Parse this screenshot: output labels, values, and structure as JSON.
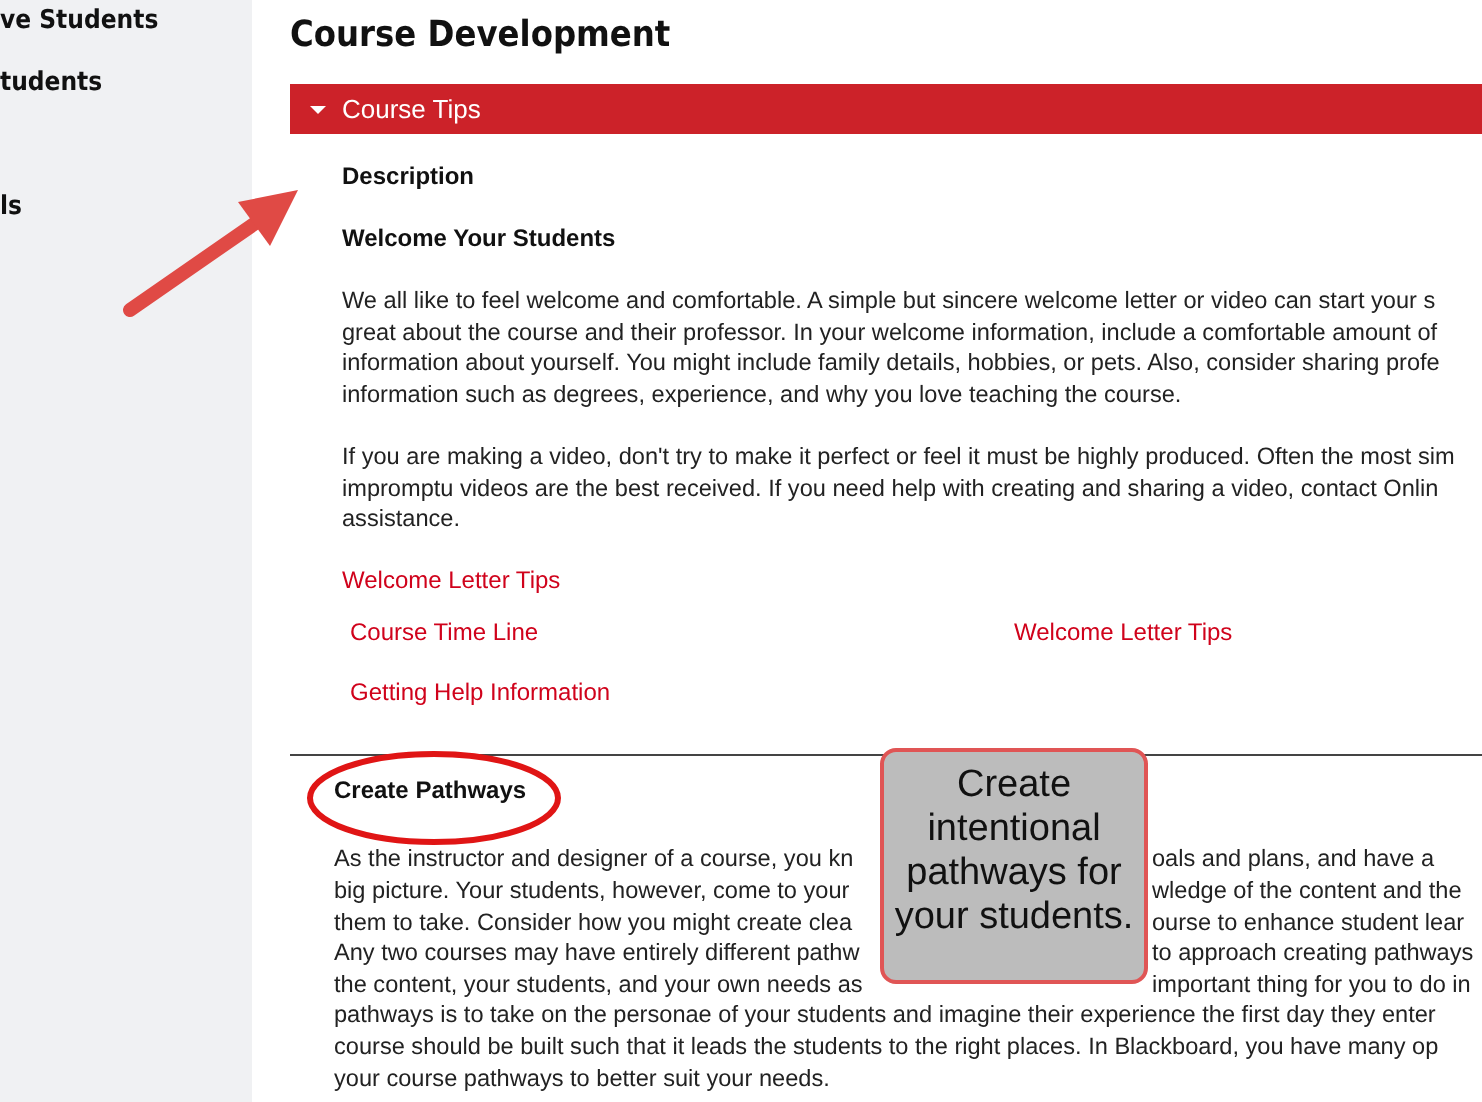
{
  "sidebar": {
    "items": [
      {
        "label": "ve Students"
      },
      {
        "label": "tudents"
      },
      {
        "label": "ls"
      }
    ]
  },
  "page_title": "Course Development",
  "section": {
    "title": "Course Tips",
    "expanded": true
  },
  "description_heading": "Description",
  "welcome": {
    "heading": "Welcome Your Students",
    "paragraphs": [
      [
        "We all like to feel welcome and comfortable. A simple but sincere welcome letter or video can start your s",
        "great about the course and their professor. In your welcome information, include a comfortable amount of",
        "information about yourself. You might include family details, hobbies, or pets. Also, consider sharing profe",
        "information such as degrees, experience, and why you love teaching the course."
      ],
      [
        "If you are making a video, don't try to make it perfect or feel it must be highly produced. Often the most sim",
        "impromptu videos are the best received. If you need help with creating and sharing a video, contact Onlin",
        "assistance."
      ]
    ]
  },
  "links": {
    "top": "Welcome Letter Tips",
    "row": [
      "Course Time Line",
      "Welcome Letter Tips"
    ],
    "bottom": "Getting Help Information"
  },
  "pathways": {
    "heading": "Create Pathways",
    "lines": [
      [
        "As the instructor and designer of a course, you kn",
        "oals and plans, and have a"
      ],
      [
        "big picture. Your students, however, come to your",
        "wledge of the content and the"
      ],
      [
        "them to take. Consider how you might create clea",
        "ourse to enhance student lear"
      ],
      [
        "Any two courses may have entirely different pathw",
        "to approach creating pathways"
      ],
      [
        "the content, your students, and your own needs as",
        "important thing for you to do in"
      ],
      [
        "pathways is to take on the personae of your students and imagine their experience the first day they enter"
      ],
      [
        "course should be built such that it leads the students to the right places. In Blackboard, you have many op"
      ],
      [
        "your course pathways to better suit your needs."
      ]
    ]
  },
  "callout": {
    "text": "Create intentional pathways for your students."
  }
}
